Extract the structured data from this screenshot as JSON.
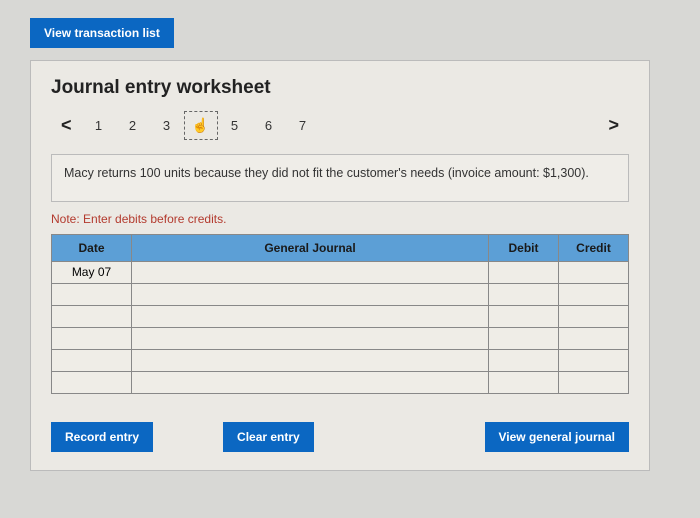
{
  "top_button": "View transaction list",
  "title": "Journal entry worksheet",
  "pager": {
    "prev": "<",
    "next": ">",
    "pages": [
      "1",
      "2",
      "3",
      "",
      "5",
      "6",
      "7"
    ],
    "active_index": 3
  },
  "description": "Macy returns 100 units because they did not fit the customer's needs (invoice amount: $1,300).",
  "note": "Note: Enter debits before credits.",
  "table": {
    "headers": {
      "date": "Date",
      "gj": "General Journal",
      "debit": "Debit",
      "credit": "Credit"
    },
    "date_value": "May 07",
    "blank_rows": 5
  },
  "buttons": {
    "record": "Record entry",
    "clear": "Clear entry",
    "view": "View general journal"
  }
}
